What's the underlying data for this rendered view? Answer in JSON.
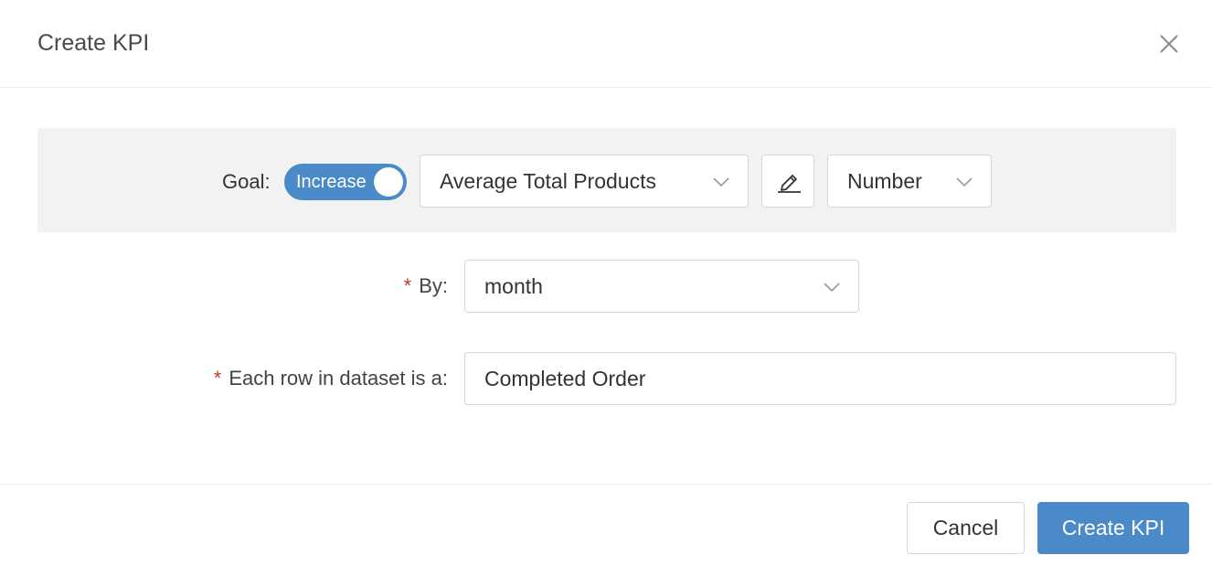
{
  "dialog": {
    "title": "Create KPI"
  },
  "goal": {
    "label": "Goal:",
    "toggle_label": "Increase",
    "toggle_on": true,
    "metric_value": "Average Total Products",
    "format_value": "Number"
  },
  "by": {
    "required_mark": "*",
    "label": "By:",
    "value": "month"
  },
  "row_type": {
    "required_mark": "*",
    "label": "Each row in dataset is a:",
    "value": "Completed Order"
  },
  "footer": {
    "cancel_label": "Cancel",
    "create_label": "Create KPI"
  },
  "colors": {
    "accent": "#4a8ac9",
    "required": "#c0392b",
    "band": "#f2f2f2"
  },
  "icons": [
    "close-icon",
    "chevron-down-icon",
    "edit-pencil-icon"
  ]
}
